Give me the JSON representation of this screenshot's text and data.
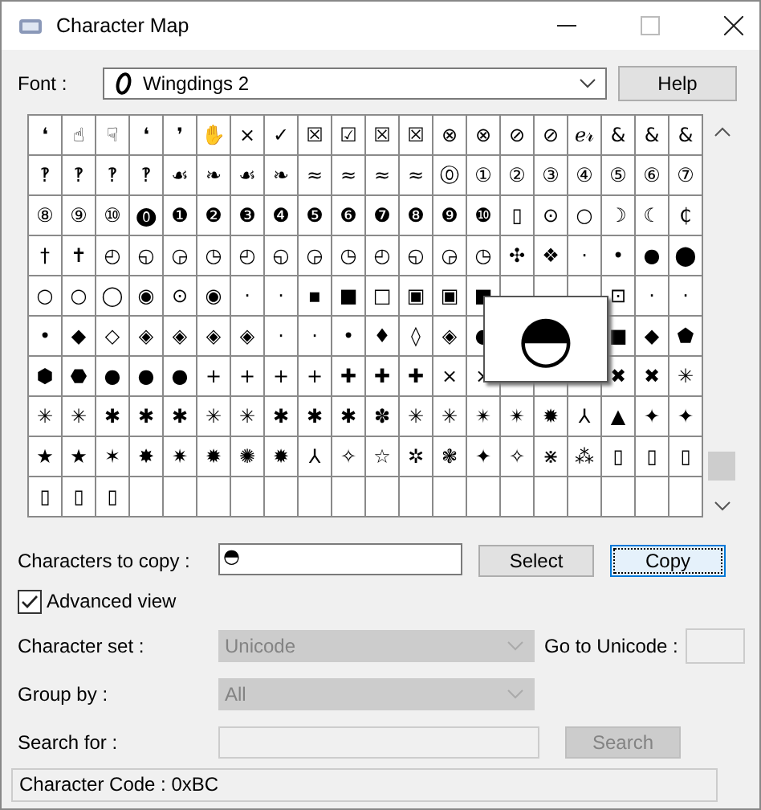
{
  "window": {
    "title": "Character Map"
  },
  "font": {
    "label": "Font :",
    "value": "Wingdings 2"
  },
  "help_button": {
    "label": "Help"
  },
  "grid": {
    "rows": [
      [
        "❛",
        "☝",
        "☟",
        "❛",
        "❜",
        "✋",
        "×",
        "✓",
        "☒",
        "☑",
        "☒",
        "☒",
        "⊗",
        "⊗",
        "⊘",
        "⊘",
        "ℯ𝓇",
        "&",
        "&",
        "&"
      ],
      [
        "‽",
        "‽",
        "‽",
        "‽",
        "☙",
        "❧",
        "☙",
        "❧",
        "≈",
        "≈",
        "≈",
        "≈",
        "⓪",
        "①",
        "②",
        "③",
        "④",
        "⑤",
        "⑥",
        "⑦"
      ],
      [
        "⑧",
        "⑨",
        "⑩",
        "⓿",
        "❶",
        "❷",
        "❸",
        "❹",
        "❺",
        "❻",
        "❼",
        "❽",
        "❾",
        "❿",
        "▯",
        "⊙",
        "○",
        "☽",
        "☾",
        "₵"
      ],
      [
        "†",
        "✝",
        "◴",
        "◵",
        "◶",
        "◷",
        "◴",
        "◵",
        "◶",
        "◷",
        "◴",
        "◵",
        "◶",
        "◷",
        "✣",
        "❖",
        "·",
        "•",
        "●",
        "⬤"
      ],
      [
        "○",
        "○",
        "◯",
        "◉",
        "⊙",
        "◉",
        "·",
        "·",
        "▪",
        "■",
        "□",
        "▣",
        "▣",
        "■",
        null,
        null,
        null,
        "⊡",
        "·",
        "·"
      ],
      [
        "•",
        "◆",
        "◇",
        "◈",
        "◈",
        "◈",
        "◈",
        "·",
        "·",
        "•",
        "♦",
        "◊",
        "◈",
        "●",
        null,
        null,
        null,
        "■",
        "◆",
        "⬟"
      ],
      [
        "⬢",
        "⬣",
        "●",
        "●",
        "●",
        "+",
        "+",
        "+",
        "+",
        "✚",
        "✚",
        "✚",
        "×",
        "×",
        null,
        null,
        null,
        "✖",
        "✖",
        "✳"
      ],
      [
        "✳",
        "✳",
        "✱",
        "✱",
        "✱",
        "✳",
        "✳",
        "✱",
        "✱",
        "✱",
        "✽",
        "✳",
        "✳",
        "✴",
        "✴",
        "✹",
        "⅄",
        "▲",
        "✦",
        "✦"
      ],
      [
        "★",
        "★",
        "✶",
        "✸",
        "✷",
        "✹",
        "✺",
        "✹",
        "⅄",
        "✧",
        "☆",
        "✲",
        "❃",
        "✦",
        "✧",
        "⋇",
        "⁂",
        "▯",
        "▯",
        "▯"
      ],
      [
        "▯",
        "▯",
        "▯"
      ]
    ],
    "magnified": "◓"
  },
  "characters_to_copy": {
    "label": "Characters to copy :",
    "value": "◓"
  },
  "buttons": [
    {
      "label": "Select",
      "focused": false
    },
    {
      "label": "Copy",
      "focused": true
    }
  ],
  "advanced_view": {
    "label": "Advanced view",
    "checked": true
  },
  "character_set": {
    "label": "Character set :",
    "value": "Unicode",
    "disabled": true
  },
  "go_to_unicode": {
    "label": "Go to Unicode :"
  },
  "group_by": {
    "label": "Group by :",
    "value": "All",
    "disabled": true
  },
  "search": {
    "label": "Search for :",
    "disabled": true,
    "button": "Search"
  },
  "status_bar": "Character Code : 0xBC"
}
